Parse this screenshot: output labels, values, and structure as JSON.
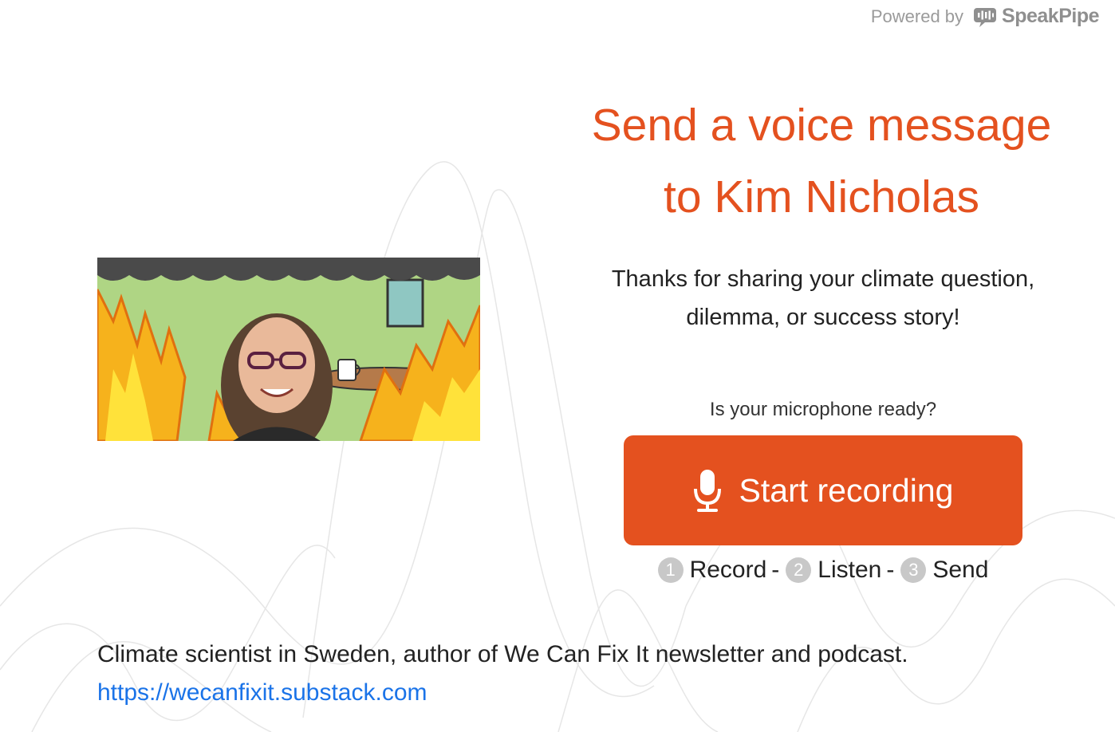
{
  "header": {
    "powered_by": "Powered by",
    "brand": "SpeakPipe"
  },
  "main": {
    "title_line1": "Send a voice message",
    "title_line2": "to Kim Nicholas",
    "subtitle_line1": "Thanks for sharing your climate question,",
    "subtitle_line2": "dilemma, or success story!",
    "mic_question": "Is your microphone ready?",
    "record_button": "Start recording",
    "steps": [
      {
        "num": "1",
        "label": "Record"
      },
      {
        "num": "2",
        "label": "Listen"
      },
      {
        "num": "3",
        "label": "Send"
      }
    ],
    "step_separator": "-"
  },
  "profile": {
    "description": "Climate scientist in Sweden, author of We Can Fix It newsletter and podcast.",
    "link": "https://wecanfixit.substack.com"
  },
  "colors": {
    "accent": "#e4511f",
    "link": "#1a73e8",
    "step_badge": "#c8c8c8"
  },
  "icons": {
    "logo": "speakpipe-logo-icon",
    "button": "microphone-icon"
  }
}
